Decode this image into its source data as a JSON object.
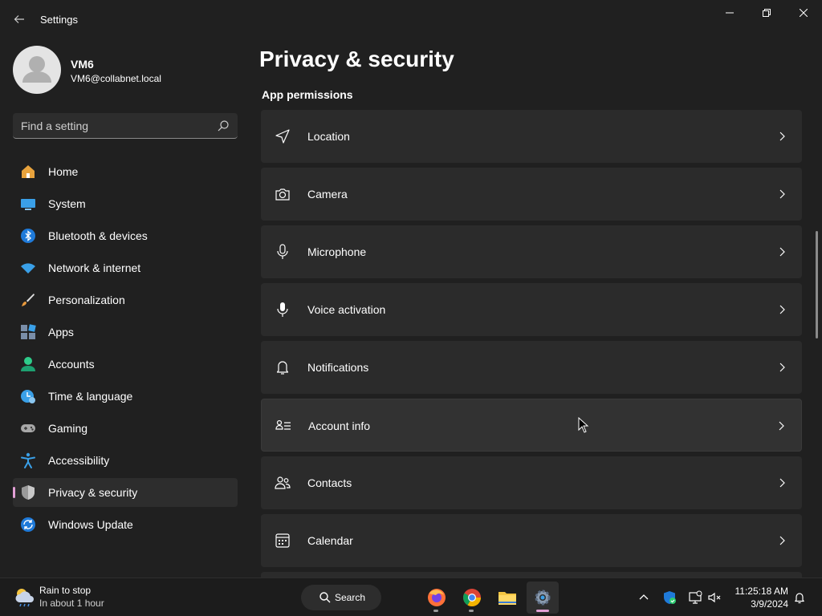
{
  "window": {
    "title": "Settings"
  },
  "profile": {
    "name": "VM6",
    "email": "VM6@collabnet.local"
  },
  "search": {
    "placeholder": "Find a setting"
  },
  "sidebar": {
    "items": [
      {
        "label": "Home",
        "icon": "home-icon"
      },
      {
        "label": "System",
        "icon": "system-icon"
      },
      {
        "label": "Bluetooth & devices",
        "icon": "bluetooth-icon"
      },
      {
        "label": "Network & internet",
        "icon": "wifi-icon"
      },
      {
        "label": "Personalization",
        "icon": "brush-icon"
      },
      {
        "label": "Apps",
        "icon": "apps-icon"
      },
      {
        "label": "Accounts",
        "icon": "accounts-icon"
      },
      {
        "label": "Time & language",
        "icon": "time-language-icon"
      },
      {
        "label": "Gaming",
        "icon": "gamepad-icon"
      },
      {
        "label": "Accessibility",
        "icon": "accessibility-icon"
      },
      {
        "label": "Privacy & security",
        "icon": "shield-icon",
        "selected": true
      },
      {
        "label": "Windows Update",
        "icon": "update-icon"
      }
    ]
  },
  "main": {
    "title": "Privacy & security",
    "section": "App permissions",
    "items": [
      {
        "label": "Location",
        "icon": "location-icon"
      },
      {
        "label": "Camera",
        "icon": "camera-icon"
      },
      {
        "label": "Microphone",
        "icon": "microphone-icon"
      },
      {
        "label": "Voice activation",
        "icon": "voice-activation-icon"
      },
      {
        "label": "Notifications",
        "icon": "bell-icon"
      },
      {
        "label": "Account info",
        "icon": "account-info-icon",
        "hovered": true
      },
      {
        "label": "Contacts",
        "icon": "contacts-icon"
      },
      {
        "label": "Calendar",
        "icon": "calendar-icon"
      }
    ]
  },
  "taskbar": {
    "weather": {
      "title": "Rain to stop",
      "subtitle": "In about 1 hour"
    },
    "search_label": "Search",
    "apps": [
      "firefox-icon",
      "chrome-icon",
      "file-explorer-icon",
      "settings-icon"
    ],
    "time": "11:25:18 AM",
    "date": "3/9/2024"
  },
  "colors": {
    "accent": "#e3a0d6",
    "background": "#202020",
    "card": "#2b2b2b"
  }
}
